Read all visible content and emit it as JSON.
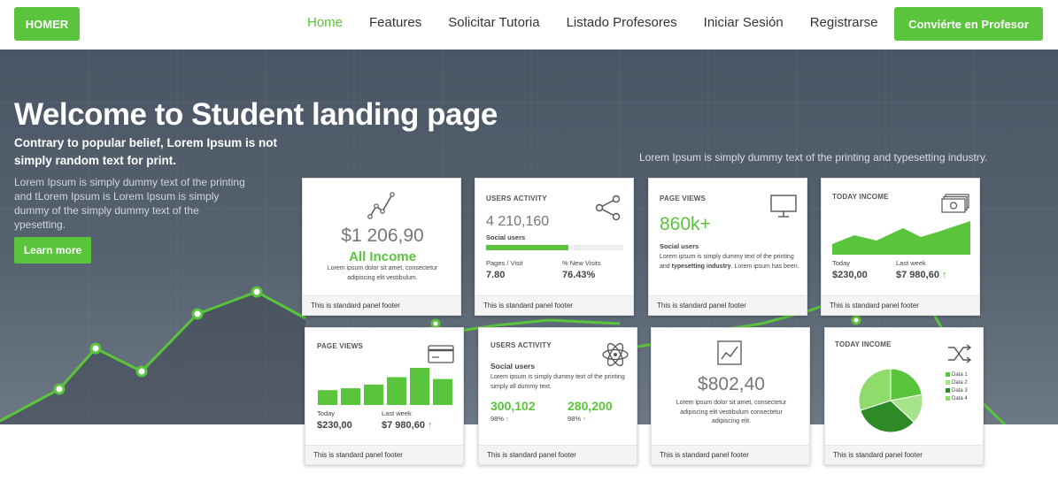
{
  "nav": {
    "brand": "HOMER",
    "links": [
      "Home",
      "Features",
      "Solicitar Tutoria",
      "Listado Profesores",
      "Iniciar Sesión",
      "Registrarse"
    ],
    "cta": "Conviérte en Profesor"
  },
  "hero": {
    "title": "Welcome to Student landing page",
    "subtitle": "Contrary to popular belief, Lorem Ipsum is not simply random text for print.",
    "body": "Lorem Ipsum is simply dummy text of the printing and tLorem Ipsum is Lorem Ipsum is simply dummy of the simply dummy text of the ypesetting.",
    "learn_more": "Learn more",
    "right_text": "Lorem Ipsum is simply dummy text of the printing and typesetting industry."
  },
  "cards": {
    "c1": {
      "value": "$1 206,90",
      "label": "All Income",
      "desc": "Lorem ipsum dolor sit amet, consectetur adipiscing elit vestibulum.",
      "footer": "This is standard panel footer"
    },
    "c2": {
      "title": "USERS ACTIVITY",
      "value": "4 210,160",
      "sub": "Social users",
      "progress": 0.6,
      "l1": "Pages / Visit",
      "l2": "% New Visits",
      "v1": "7.80",
      "v2": "76.43%",
      "footer": "This is standard panel footer"
    },
    "c3": {
      "title": "PAGE VIEWS",
      "value": "860k+",
      "sub": "Social users",
      "desc_a": "Lorem ipsum is simply dummy text of the printing and ",
      "desc_b": "typesetting industry",
      "desc_c": ". Lorem ipsum has been.",
      "footer": "This is standard panel footer"
    },
    "c4": {
      "title": "TODAY INCOME",
      "l1": "Today",
      "l2": "Last week",
      "v1": "$230,00",
      "v2": "$7 980,60",
      "footer": "This is standard panel footer"
    },
    "c5": {
      "title": "PAGE VIEWS",
      "l1": "Today",
      "l2": "Last week",
      "v1": "$230,00",
      "v2": "$7 980,60",
      "footer": "This is standard panel footer"
    },
    "c6": {
      "title": "USERS ACTIVITY",
      "sub": "Social users",
      "desc": "Lorem ipsum is simply dummy text of the printing simply all dummy text.",
      "g1": "300,102",
      "g2": "280,200",
      "p1": "98%",
      "p2": "98%",
      "footer": "This is standard panel footer"
    },
    "c7": {
      "value": "$802,40",
      "desc": "Lorem ipsum dolor sit amet, consectetur adipiscing elit vestibulum consectetur adipiscing elit.",
      "footer": "This is standard panel footer"
    },
    "c8": {
      "title": "TODAY INCOME",
      "legend": [
        "Data 1",
        "Data 2",
        "Data 3",
        "Data 4"
      ],
      "footer": "This is standard panel footer"
    }
  },
  "chart_data": [
    {
      "type": "bar",
      "categories": [
        "1",
        "2",
        "3",
        "4",
        "5",
        "6"
      ],
      "values": [
        40,
        45,
        55,
        75,
        100,
        70
      ]
    },
    {
      "type": "pie",
      "categories": [
        "Data 1",
        "Data 2",
        "Data 3",
        "Data 4"
      ],
      "values": [
        22,
        15,
        33,
        30
      ]
    }
  ],
  "colors": {
    "accent": "#5ac43c",
    "hero_bg": "#4f5b68",
    "dark_green": "#2e8a26",
    "light_green": "#8fdc6c"
  },
  "icons": [
    "trend-line-icon",
    "share-icon",
    "monitor-icon",
    "money-icon",
    "credit-card-icon",
    "atom-icon",
    "line-chart-icon",
    "shuffle-icon",
    "trend-up-arrow-icon"
  ]
}
